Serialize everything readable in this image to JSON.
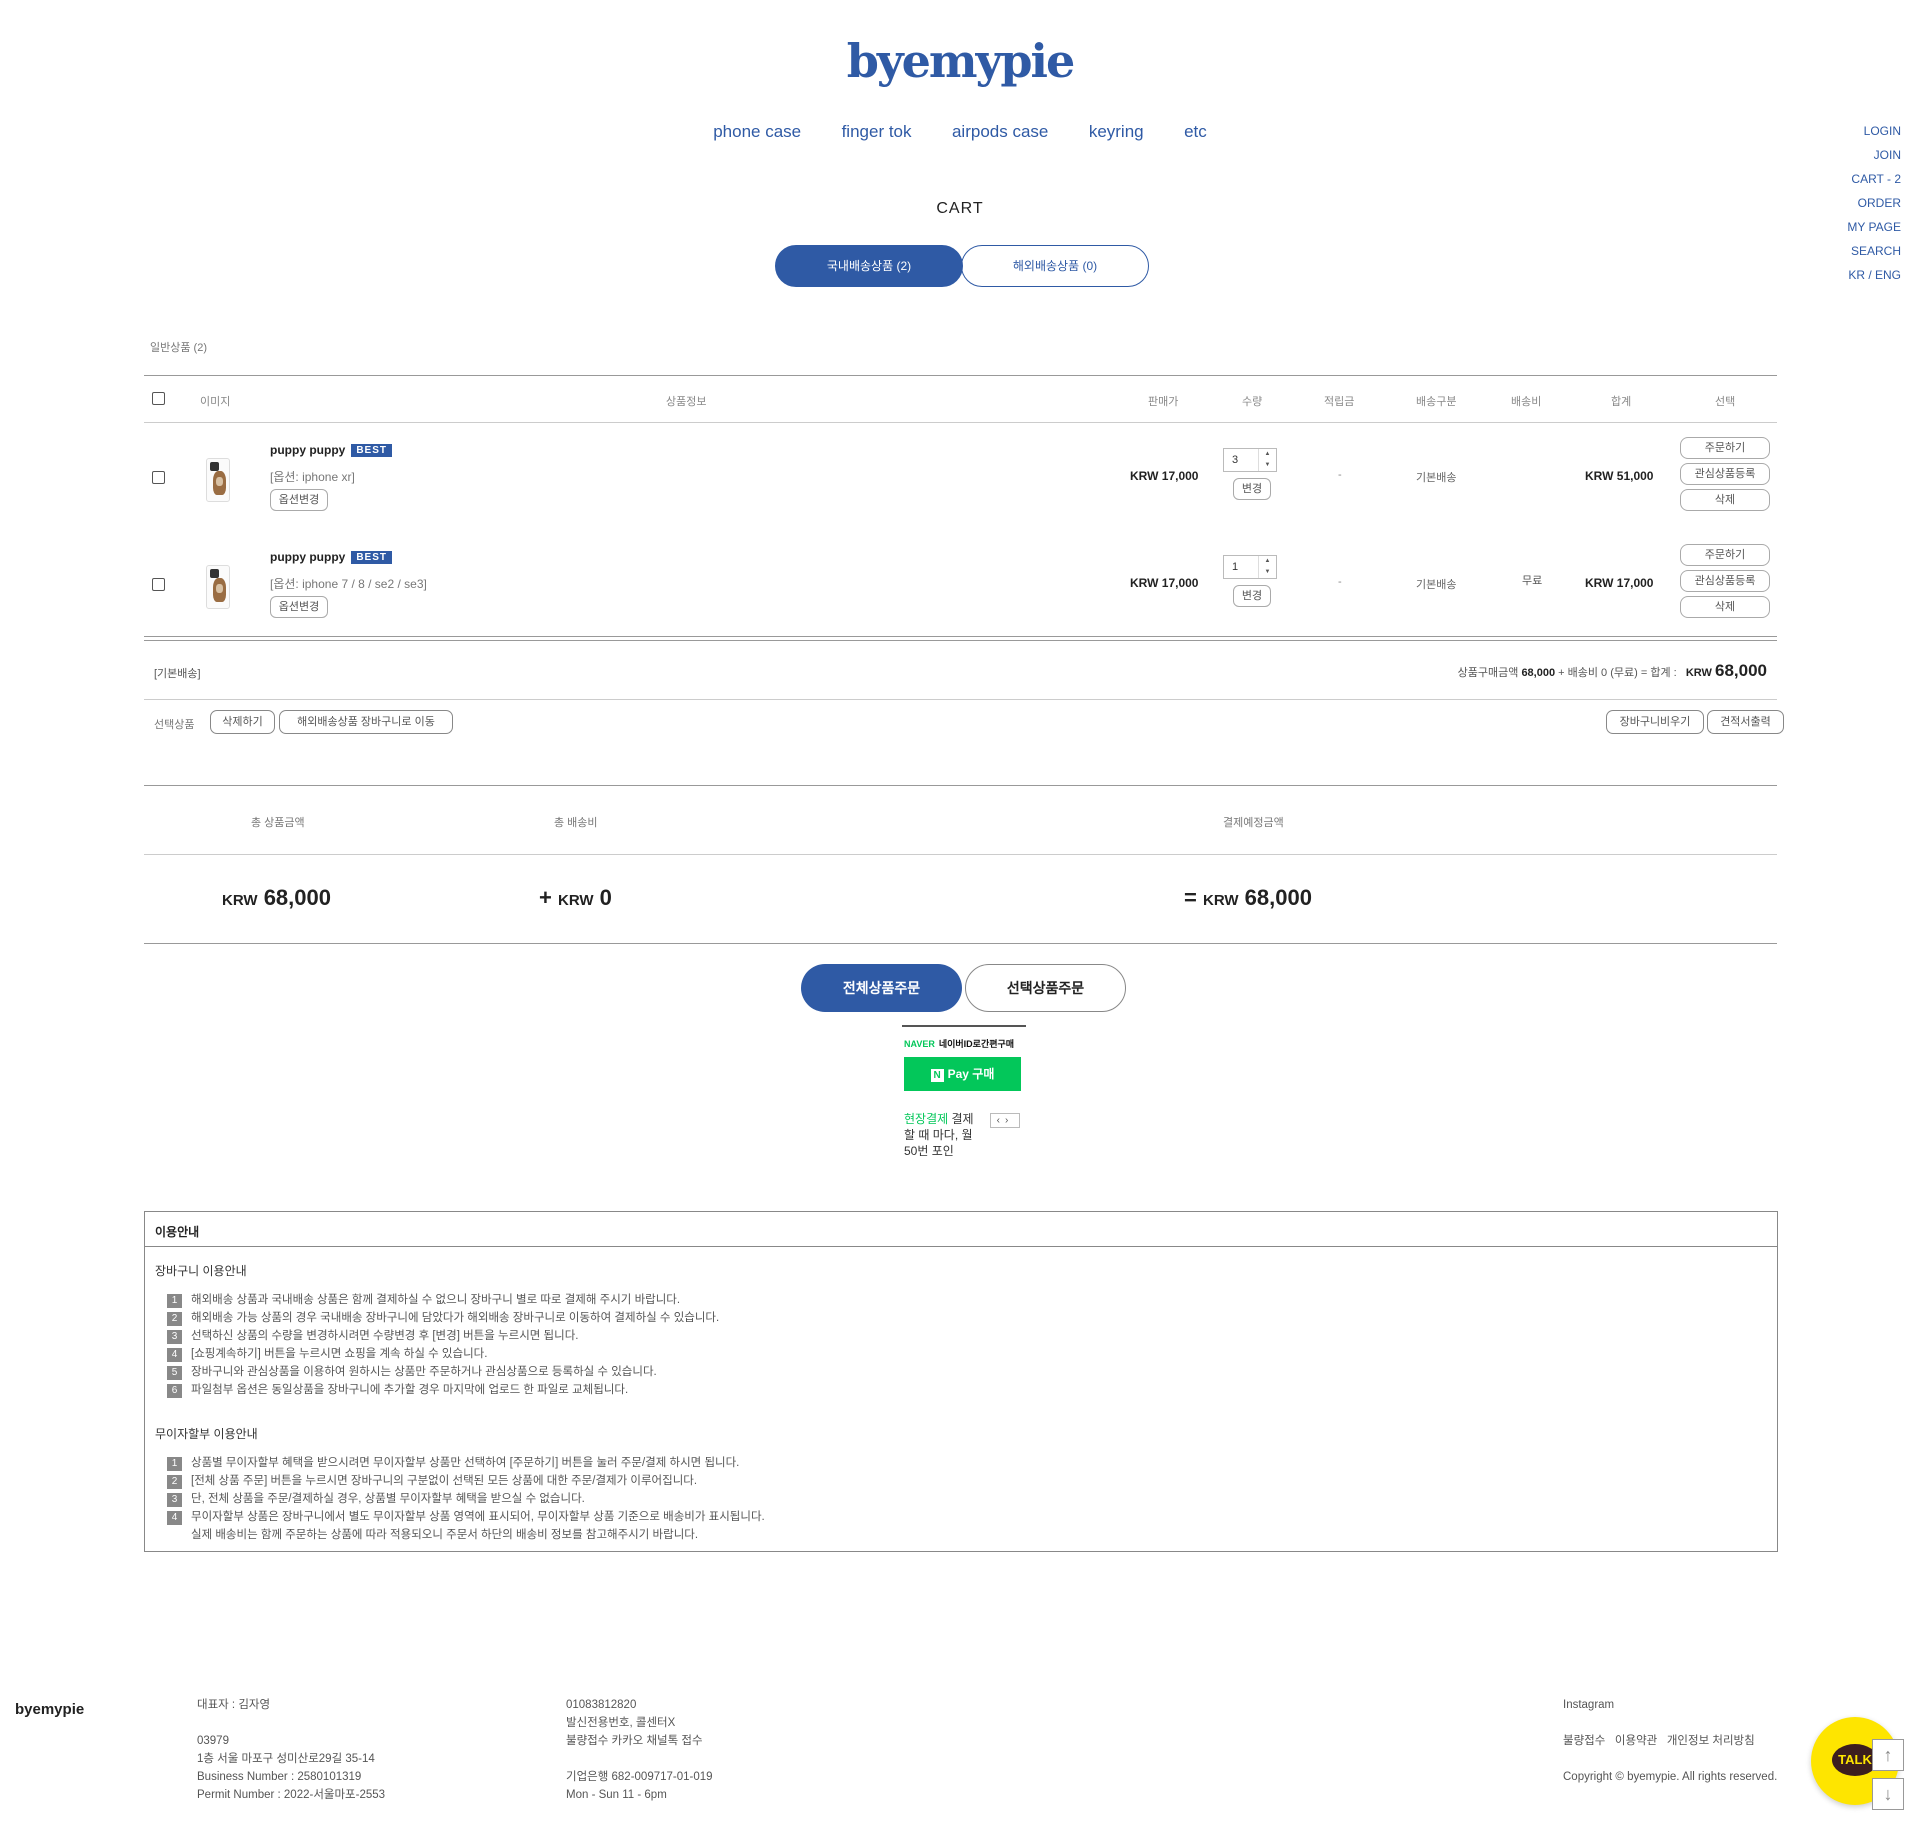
{
  "brand": {
    "logo": "byemypie"
  },
  "nav": [
    "phone case",
    "finger tok",
    "airpods case",
    "keyring",
    "etc"
  ],
  "side_menu": [
    "LOGIN",
    "JOIN",
    "CART - 2",
    "ORDER",
    "MY PAGE",
    "SEARCH",
    "KR / ENG"
  ],
  "page_title": "CART",
  "tabs": {
    "domestic": "국내배송상품 (2)",
    "overseas": "해외배송상품 (0)"
  },
  "section_label": "일반상품 (2)",
  "table_headers": {
    "image": "이미지",
    "info": "상품정보",
    "price": "판매가",
    "qty": "수량",
    "points": "적립금",
    "ship_type": "배송구분",
    "ship_fee": "배송비",
    "total": "합계",
    "select": "선택"
  },
  "items": [
    {
      "name": "puppy puppy",
      "badge": "BEST",
      "option": "[옵션: iphone xr]",
      "option_btn": "옵션변경",
      "price": "KRW 17,000",
      "qty": "3",
      "qty_btn": "변경",
      "points": "-",
      "ship_type": "기본배송",
      "total": "KRW 51,000",
      "actions": [
        "주문하기",
        "관심상품등록",
        "삭제"
      ]
    },
    {
      "name": "puppy puppy",
      "badge": "BEST",
      "option": "[옵션: iphone 7 / 8 / se2 / se3]",
      "option_btn": "옵션변경",
      "price": "KRW 17,000",
      "qty": "1",
      "qty_btn": "변경",
      "points": "-",
      "ship_type": "기본배송",
      "total": "KRW 17,000",
      "actions": [
        "주문하기",
        "관심상품등록",
        "삭제"
      ]
    }
  ],
  "ship_fee": "무료",
  "summary": {
    "label": "[기본배송]",
    "text": "상품구매금액",
    "amount": "68,000",
    "mid": " + 배송비 0 (무료) = 합계 :",
    "currency": "KRW",
    "total": "68,000"
  },
  "selection": {
    "label": "선택상품",
    "delete": "삭제하기",
    "move": "해외배송상품 장바구니로 이동",
    "clear": "장바구니비우기",
    "estimate": "견적서출력"
  },
  "totals": {
    "head_products": "총 상품금액",
    "head_shipping": "총 배송비",
    "head_payment": "결제예정금액",
    "products_cur": "KRW",
    "products_amt": "68,000",
    "shipping_prefix": "+",
    "shipping_cur": "KRW",
    "shipping_amt": "0",
    "payment_prefix": "=",
    "payment_cur": "KRW",
    "payment_amt": "68,000"
  },
  "order_buttons": {
    "all": "전체상품주문",
    "selected": "선택상품주문"
  },
  "npay": {
    "naver": "NAVER",
    "head": "네이버ID로간편구매",
    "n": "N",
    "btn": "Pay 구매",
    "green": "현장결제",
    "text": " 결제할 때 마다, 월 50번 포인",
    "arrows": "‹›"
  },
  "guide": {
    "title": "이용안내",
    "cart_title": "장바구니 이용안내",
    "cart_items": [
      "해외배송 상품과 국내배송 상품은 함께 결제하실 수 없으니 장바구니 별로 따로 결제해 주시기 바랍니다.",
      "해외배송 가능 상품의 경우 국내배송 장바구니에 담았다가 해외배송 장바구니로 이동하여 결제하실 수 있습니다.",
      "선택하신 상품의 수량을 변경하시려면 수량변경 후 [변경] 버튼을 누르시면 됩니다.",
      "[쇼핑계속하기] 버튼을 누르시면 쇼핑을 계속 하실 수 있습니다.",
      "장바구니와 관심상품을 이용하여 원하시는 상품만 주문하거나 관심상품으로 등록하실 수 있습니다.",
      "파일첨부 옵션은 동일상품을 장바구니에 추가할 경우 마지막에 업로드 한 파일로 교체됩니다."
    ],
    "installment_title": "무이자할부 이용안내",
    "installment_items": [
      "상품별 무이자할부 혜택을 받으시려면 무이자할부 상품만 선택하여 [주문하기] 버튼을 눌러 주문/결제 하시면 됩니다.",
      "[전체 상품 주문] 버튼을 누르시면 장바구니의 구분없이 선택된 모든 상품에 대한 주문/결제가 이루어집니다.",
      "단, 전체 상품을 주문/결제하실 경우, 상품별 무이자할부 혜택을 받으실 수 없습니다.",
      "무이자할부 상품은 장바구니에서 별도 무이자할부 상품 영역에 표시되어, 무이자할부 상품 기준으로 배송비가 표시됩니다."
    ],
    "installment_note": "실제 배송비는 함께 주문하는 상품에 따라 적용되오니 주문서 하단의 배송비 정보를 참고해주시기 바랍니다."
  },
  "footer": {
    "brand": "byemypie",
    "ceo": "대표자 : 김자영",
    "zip": "03979",
    "address": "1층 서울 마포구 성미산로29길 35-14",
    "business": "Business Number : 2580101319",
    "permit": "Permit Number : 2022-서울마포-2553",
    "phone": "01083812820",
    "phone_note": "발신전용번호, 콜센터X",
    "claim": "불량접수 카카오 채널톡 접수",
    "bank": "기업은행 682-009717-01-019",
    "hours": "Mon - Sun 11 - 6pm",
    "instagram": "Instagram",
    "links": [
      "불량접수",
      "이용약관",
      "개인정보 처리방침"
    ],
    "copyright": "Copyright © byemypie. All rights reserved.",
    "talk": "TALK"
  },
  "colors": {
    "accent": "#2f5aa5",
    "naver": "#03c75a",
    "kakao": "#fee500"
  }
}
